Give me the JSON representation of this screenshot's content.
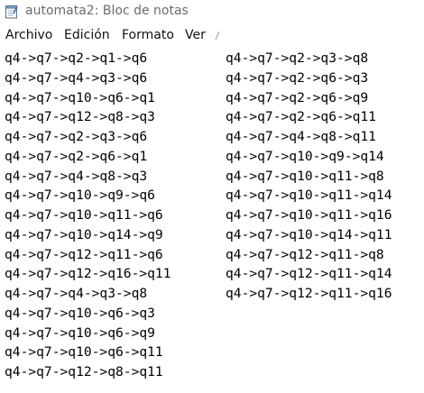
{
  "window": {
    "title": "automata2: Bloc de notas"
  },
  "menu": {
    "items": [
      "Archivo",
      "Edición",
      "Formato",
      "Ver"
    ]
  },
  "editor": {
    "left_lines": [
      "q4->q7->q2->q1->q6",
      "q4->q7->q4->q3->q6",
      "q4->q7->q10->q6->q1",
      "q4->q7->q12->q8->q3",
      "q4->q7->q2->q3->q6",
      "q4->q7->q2->q6->q1",
      "q4->q7->q4->q8->q3",
      "q4->q7->q10->q9->q6",
      "q4->q7->q10->q11->q6",
      "q4->q7->q10->q14->q9",
      "q4->q7->q12->q11->q6",
      "q4->q7->q12->q16->q11",
      "q4->q7->q4->q3->q8",
      "q4->q7->q10->q6->q3",
      "q4->q7->q10->q6->q9",
      "q4->q7->q10->q6->q11",
      "q4->q7->q12->q8->q11"
    ],
    "right_lines": [
      "q4->q7->q2->q3->q8",
      "q4->q7->q2->q6->q3",
      "q4->q7->q2->q6->q9",
      "q4->q7->q2->q6->q11",
      "q4->q7->q4->q8->q11",
      "q4->q7->q10->q9->q14",
      "q4->q7->q10->q11->q8",
      "q4->q7->q10->q11->q14",
      "q4->q7->q10->q11->q16",
      "q4->q7->q10->q14->q11",
      "q4->q7->q12->q11->q8",
      "q4->q7->q12->q11->q14",
      "q4->q7->q12->q11->q16"
    ]
  },
  "icons": {
    "app": "notepad-icon",
    "overflow": "menu-overflow-indicator"
  }
}
